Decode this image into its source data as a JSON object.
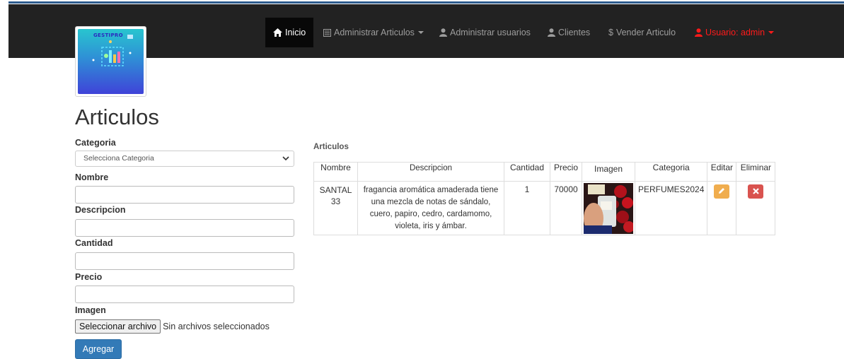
{
  "nav": {
    "items": [
      {
        "label": "Inicio",
        "icon": "home-icon",
        "active": true
      },
      {
        "label": "Administrar Articulos",
        "icon": "list-icon",
        "dropdown": true
      },
      {
        "label": "Administrar usuarios",
        "icon": "user-icon"
      },
      {
        "label": "Clientes",
        "icon": "user-icon"
      },
      {
        "label": "Vender Articulo",
        "icon": "dollar-icon"
      },
      {
        "label": "Usuario: admin",
        "icon": "user-icon",
        "dropdown": true,
        "color": "#ff1a1a"
      }
    ]
  },
  "logo": {
    "text": "GESTIPRO"
  },
  "page": {
    "title": "Articulos"
  },
  "form": {
    "categoria_label": "Categoria",
    "categoria_selected": "Selecciona Categoria",
    "nombre_label": "Nombre",
    "descripcion_label": "Descripcion",
    "cantidad_label": "Cantidad",
    "precio_label": "Precio",
    "imagen_label": "Imagen",
    "file_button": "Seleccionar archivo",
    "file_status": "Sin archivos seleccionados",
    "submit": "Agregar"
  },
  "table": {
    "caption": "Articulos",
    "headers": [
      "Nombre",
      "Descripcion",
      "Cantidad",
      "Precio",
      "Imagen",
      "Categoria",
      "Editar",
      "Eliminar"
    ],
    "rows": [
      {
        "nombre": "SANTAL 33",
        "descripcion": "fragancia aromática amaderada tiene una mezcla de notas de sándalo, cuero, papiro, cedro, cardamomo, violeta, iris y ámbar.",
        "cantidad": "1",
        "precio": "70000",
        "categoria": "PERFUMES2024"
      }
    ]
  },
  "colors": {
    "navbar": "#222222",
    "primary": "#337ab7",
    "warning": "#f0ad4e",
    "danger": "#d9534f",
    "user": "#ff1a1a"
  }
}
